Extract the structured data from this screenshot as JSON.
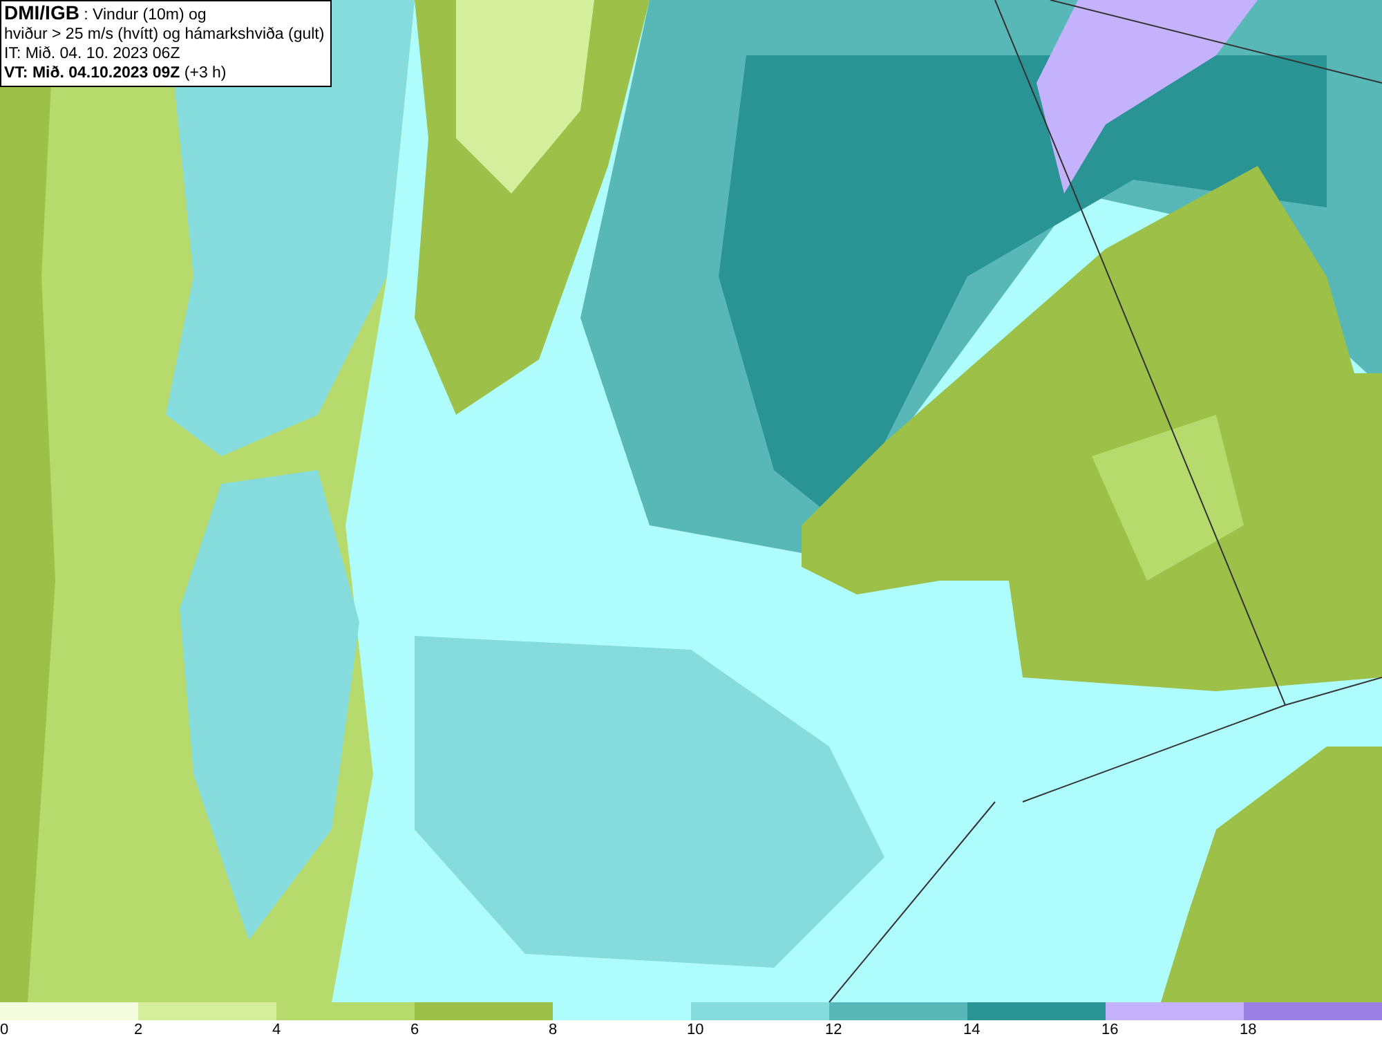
{
  "title_box": {
    "lines": [
      "**DMI/IGB** : Vindur (10m) og",
      "hviður > 25 m/s (hvítt) og hámarkshviða (gult)",
      "IT: Mið. 04. 10. 2023 06Z",
      "**VT: Mið. 04.10.2023 09Z** (+3 h)"
    ]
  },
  "legend": [
    {
      "color": "#f4fde0",
      "label": "0"
    },
    {
      "color": "#d4ee9c",
      "label": "2"
    },
    {
      "color": "#b6da6c",
      "label": "4"
    },
    {
      "color": "#9cc048",
      "label": "6"
    },
    {
      "color": "#aefcfb",
      "label": "8"
    },
    {
      "color": "#86dcdc",
      "label": "10"
    },
    {
      "color": "#58b8b8",
      "label": "12"
    },
    {
      "color": "#2a9494",
      "label": "14"
    },
    {
      "color": "#c4b2fc",
      "label": "16"
    },
    {
      "color": "#9a80e2",
      "label": "18"
    }
  ]
}
